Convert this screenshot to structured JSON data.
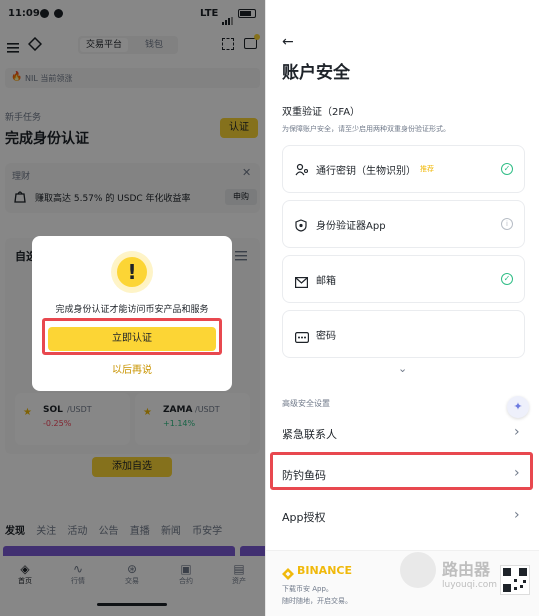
{
  "left": {
    "status": {
      "time": "11:09",
      "network": "LTE"
    },
    "header": {
      "tabs": [
        "交易平台",
        "钱包"
      ],
      "active_tab": 0
    },
    "search": {
      "placeholder": "NIL 当前领涨"
    },
    "task": {
      "section": "新手任务",
      "title": "完成身份认证",
      "button": "认证"
    },
    "finance": {
      "label": "理财",
      "text": "赚取高达 5.57% 的 USDC 年化收益率",
      "button": "申购"
    },
    "watchlist": {
      "label": "自选"
    },
    "coins": [
      {
        "symbol": "SOL",
        "pair": "/USDT",
        "change": "-0.25%"
      },
      {
        "symbol": "ZAMA",
        "pair": "/USDT",
        "change": "+1.14%"
      }
    ],
    "add_watchlist": "添加自选",
    "feed_tabs": [
      "发现",
      "关注",
      "活动",
      "公告",
      "直播",
      "新闻",
      "币安学"
    ],
    "bottom_nav": [
      "首页",
      "行情",
      "交易",
      "合约",
      "资产"
    ],
    "modal": {
      "icon": "!",
      "message": "完成身份认证才能访问币安产品和服务",
      "primary": "立即认证",
      "secondary": "以后再说"
    }
  },
  "right": {
    "title": "账户安全",
    "twofa_title": "双重验证（2FA）",
    "twofa_desc": "为保障账户安全，请至少启用两种双重身份验证形式。",
    "methods": [
      {
        "label": "通行密钥（生物识别）",
        "badge": "推荐",
        "status": "enabled"
      },
      {
        "label": "身份验证器App",
        "status": "info"
      },
      {
        "label": "邮箱",
        "status": "enabled"
      },
      {
        "label": "密码",
        "status": "none"
      }
    ],
    "advanced_title": "高级安全设置",
    "advanced_items": [
      "紧急联系人",
      "防钓鱼码",
      "App授权"
    ],
    "footer": {
      "brand": "BINANCE",
      "line1": "下载币安 App。",
      "line2": "随时随地，开启交易。"
    },
    "watermark": {
      "cn": "路由器",
      "en": "luyouqi.com"
    }
  },
  "colors": {
    "accent": "#fcd535",
    "success": "#2ebd85",
    "danger": "#f6465d",
    "highlight": "#e8484f"
  }
}
